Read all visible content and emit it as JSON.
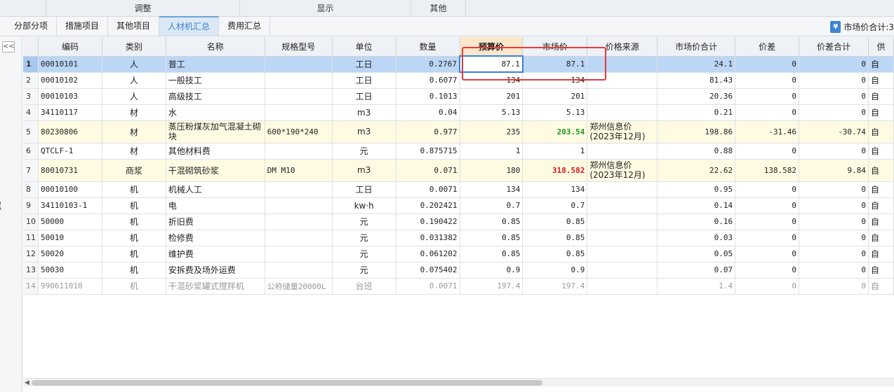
{
  "groups": [
    "调整",
    "显示",
    "其他"
  ],
  "tabs": [
    "分部分项",
    "措施项目",
    "其他项目",
    "人材机汇总",
    "费用汇总"
  ],
  "active_tab": "人材机汇总",
  "market_total_label": "市场价合计:3",
  "left_fragment": "(",
  "collapse_label": "<<",
  "columns": [
    "编码",
    "类别",
    "名称",
    "规格型号",
    "单位",
    "数量",
    "预算价",
    "市场价",
    "价格来源",
    "市场价合计",
    "价差",
    "价差合计",
    "供"
  ],
  "rows": [
    {
      "no": "1",
      "code": "00010101",
      "cat": "人",
      "name": "普工",
      "spec": "",
      "unit": "工日",
      "qty": "0.2767",
      "budget": "87.1",
      "market": "87.1",
      "source": "",
      "mtotal": "24.1",
      "diff": "0",
      "dtotal": "0",
      "supply": "自"
    },
    {
      "no": "2",
      "code": "00010102",
      "cat": "人",
      "name": "一般技工",
      "spec": "",
      "unit": "工日",
      "qty": "0.6077",
      "budget": "134",
      "market": "134",
      "source": "",
      "mtotal": "81.43",
      "diff": "0",
      "dtotal": "0",
      "supply": "自"
    },
    {
      "no": "3",
      "code": "00010103",
      "cat": "人",
      "name": "高级技工",
      "spec": "",
      "unit": "工日",
      "qty": "0.1013",
      "budget": "201",
      "market": "201",
      "source": "",
      "mtotal": "20.36",
      "diff": "0",
      "dtotal": "0",
      "supply": "自"
    },
    {
      "no": "4",
      "code": "34110117",
      "cat": "材",
      "name": "水",
      "spec": "",
      "unit": "m3",
      "qty": "0.04",
      "budget": "5.13",
      "market": "5.13",
      "source": "",
      "mtotal": "0.21",
      "diff": "0",
      "dtotal": "0",
      "supply": "自"
    },
    {
      "no": "5",
      "code": "80230806",
      "cat": "材",
      "name": "蒸压粉煤灰加气混凝土砌块",
      "spec": "600*190*240",
      "unit": "m3",
      "qty": "0.977",
      "budget": "235",
      "market": "203.54",
      "source": "郑州信息价(2023年12月)",
      "mtotal": "198.86",
      "diff": "-31.46",
      "dtotal": "-30.74",
      "supply": "自"
    },
    {
      "no": "6",
      "code": "QTCLF-1",
      "cat": "材",
      "name": "其他材料费",
      "spec": "",
      "unit": "元",
      "qty": "0.875715",
      "budget": "1",
      "market": "1",
      "source": "",
      "mtotal": "0.88",
      "diff": "0",
      "dtotal": "0",
      "supply": "自"
    },
    {
      "no": "7",
      "code": "80010731",
      "cat": "商浆",
      "name": "干混砌筑砂浆",
      "spec": "DM M10",
      "unit": "m3",
      "qty": "0.071",
      "budget": "180",
      "market": "318.582",
      "source": "郑州信息价(2023年12月)",
      "mtotal": "22.62",
      "diff": "138.582",
      "dtotal": "9.84",
      "supply": "自"
    },
    {
      "no": "8",
      "code": "00010100",
      "cat": "机",
      "name": "机械人工",
      "spec": "",
      "unit": "工日",
      "qty": "0.0071",
      "budget": "134",
      "market": "134",
      "source": "",
      "mtotal": "0.95",
      "diff": "0",
      "dtotal": "0",
      "supply": "自"
    },
    {
      "no": "9",
      "code": "34110103-1",
      "cat": "机",
      "name": "电",
      "spec": "",
      "unit": "kw·h",
      "qty": "0.202421",
      "budget": "0.7",
      "market": "0.7",
      "source": "",
      "mtotal": "0.14",
      "diff": "0",
      "dtotal": "0",
      "supply": "自"
    },
    {
      "no": "10",
      "code": "50000",
      "cat": "机",
      "name": "折旧费",
      "spec": "",
      "unit": "元",
      "qty": "0.190422",
      "budget": "0.85",
      "market": "0.85",
      "source": "",
      "mtotal": "0.16",
      "diff": "0",
      "dtotal": "0",
      "supply": "自"
    },
    {
      "no": "11",
      "code": "50010",
      "cat": "机",
      "name": "检修费",
      "spec": "",
      "unit": "元",
      "qty": "0.031382",
      "budget": "0.85",
      "market": "0.85",
      "source": "",
      "mtotal": "0.03",
      "diff": "0",
      "dtotal": "0",
      "supply": "自"
    },
    {
      "no": "12",
      "code": "50020",
      "cat": "机",
      "name": "维护费",
      "spec": "",
      "unit": "元",
      "qty": "0.061202",
      "budget": "0.85",
      "market": "0.85",
      "source": "",
      "mtotal": "0.05",
      "diff": "0",
      "dtotal": "0",
      "supply": "自"
    },
    {
      "no": "13",
      "code": "50030",
      "cat": "机",
      "name": "安拆费及场外运费",
      "spec": "",
      "unit": "元",
      "qty": "0.075402",
      "budget": "0.9",
      "market": "0.9",
      "source": "",
      "mtotal": "0.07",
      "diff": "0",
      "dtotal": "0",
      "supply": "自"
    },
    {
      "no": "14",
      "code": "990611010",
      "cat": "机",
      "name": "干混砂浆罐式搅拌机",
      "spec": "公称储量20000L",
      "unit": "台班",
      "qty": "0.0071",
      "budget": "197.4",
      "market": "197.4",
      "source": "",
      "mtotal": "1.4",
      "diff": "0",
      "dtotal": "0",
      "supply": "自"
    }
  ],
  "colors": {
    "selected_row": "#bcd6f5",
    "highlight_header": "#fbe7c9",
    "annotation_box": "#e63a3a",
    "price_down": "#1f9a1f",
    "price_up": "#d61a1a"
  }
}
